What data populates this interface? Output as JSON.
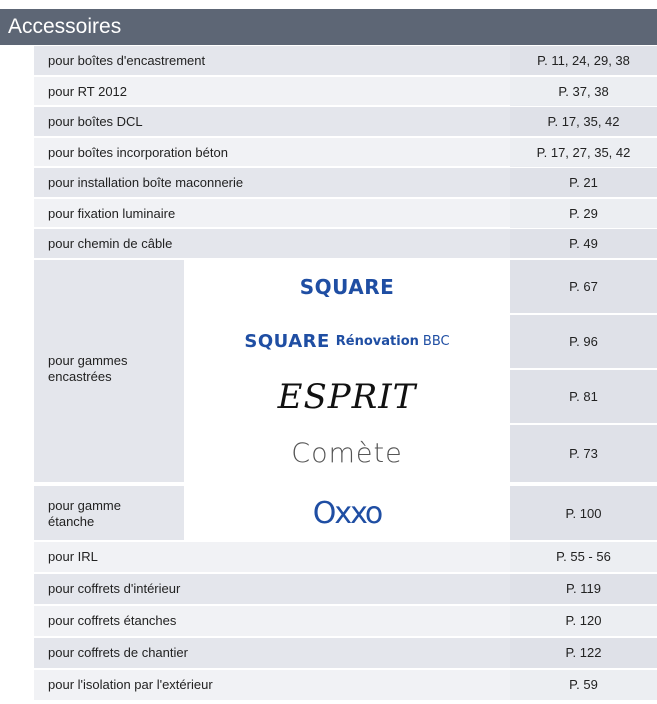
{
  "title": "Accessoires",
  "rows_top": [
    {
      "label": "pour boîtes d'encastrement",
      "page": "P. 11, 24, 29, 38"
    },
    {
      "label": "pour RT 2012",
      "page": "P. 37, 38"
    },
    {
      "label": "pour boîtes DCL",
      "page": "P. 17, 35, 42"
    },
    {
      "label": "pour boîtes incorporation béton",
      "page": "P. 17, 27, 35, 42"
    },
    {
      "label": "pour installation boîte maconnerie",
      "page": "P. 21"
    },
    {
      "label": "pour fixation luminaire",
      "page": "P. 29"
    },
    {
      "label": "pour chemin de câble",
      "page": "P. 49"
    }
  ],
  "encastrees": {
    "label_line1": "pour gammes",
    "label_line2": "encastrées",
    "items": [
      {
        "logo": "SQUARE",
        "page": "P. 67"
      },
      {
        "logo": "SQUARE",
        "logo_sub": "Rénovation",
        "logo_sub2": "BBC",
        "page": "P. 96"
      },
      {
        "logo": "ESPRIT",
        "page": "P. 81"
      },
      {
        "logo": "Comète",
        "page": "P. 73"
      }
    ]
  },
  "etanche": {
    "label_line1": "pour gamme",
    "label_line2": "étanche",
    "logo": "Oxxo",
    "page": "P. 100"
  },
  "rows_bottom": [
    {
      "label": "pour IRL",
      "page": "P. 55 - 56"
    },
    {
      "label": "pour coffrets d'intérieur",
      "page": "P. 119"
    },
    {
      "label": "pour coffrets étanches",
      "page": "P. 120"
    },
    {
      "label": "pour coffrets de chantier",
      "page": "P. 122"
    },
    {
      "label": "pour l'isolation par l'extérieur",
      "page": "P. 59"
    }
  ]
}
